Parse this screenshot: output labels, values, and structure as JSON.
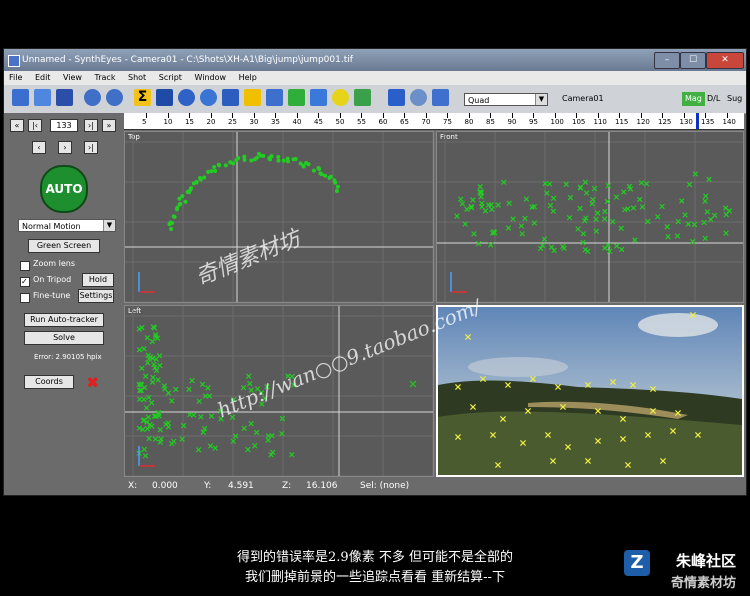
{
  "window": {
    "title": "Unnamed - SynthEyes - Camera01 - C:\\Shots\\XH-A1\\Big\\jump\\jump001.tif",
    "controls": [
      "–",
      "☐",
      "✕"
    ]
  },
  "menu": [
    "File",
    "Edit",
    "View",
    "Track",
    "Shot",
    "Script",
    "Window",
    "Help"
  ],
  "toolbar": {
    "view_select": "Quad",
    "camera_label": "Camera01",
    "modes": [
      "Mag",
      "D/L",
      "Sug"
    ]
  },
  "frame": {
    "current": "133",
    "ruler_ticks": [
      "5",
      "10",
      "15",
      "20",
      "25",
      "30",
      "35",
      "40",
      "45",
      "50",
      "55",
      "60",
      "65",
      "70",
      "75",
      "80",
      "85",
      "90",
      "95",
      "100",
      "105",
      "110",
      "115",
      "120",
      "125",
      "130",
      "135",
      "140"
    ]
  },
  "left_panel": {
    "auto_label": "AUTO",
    "motion_select": "Normal Motion",
    "green_screen_label": "Green Screen",
    "zoom_lens_label": "Zoom lens",
    "on_tripod_label": "On Tripod",
    "hold_label": "Hold",
    "fine_tune_label": "Fine-tune",
    "settings_label": "Settings",
    "run_autotracker_label": "Run Auto-tracker",
    "solve_label": "Solve",
    "error_text": "Error: 2.90105 hpix",
    "coords_label": "Coords"
  },
  "viewports": {
    "top": "Top",
    "front": "Front",
    "left": "Left"
  },
  "status": {
    "x_label": "X:",
    "x_value": "0.000",
    "y_label": "Y:",
    "y_value": "4.591",
    "z_label": "Z:",
    "z_value": "16.106",
    "sel": "Sel: (none)"
  },
  "subtitles": [
    "得到的错误率是2.9像素 不多 但可能不是全部的",
    "我们删掉前景的一些追踪点看看 重新结算--下"
  ],
  "watermark": {
    "line1": "奇情素材坊",
    "line2": "http://wan○○9.taobao.com/"
  },
  "brand": {
    "line1": "朱峰社区",
    "line2": "奇情素材坊"
  },
  "colors": {
    "tracker_green": "#22cc22",
    "tracker_yellow": "#eeee44",
    "auto_button": "#1e8f2e"
  }
}
